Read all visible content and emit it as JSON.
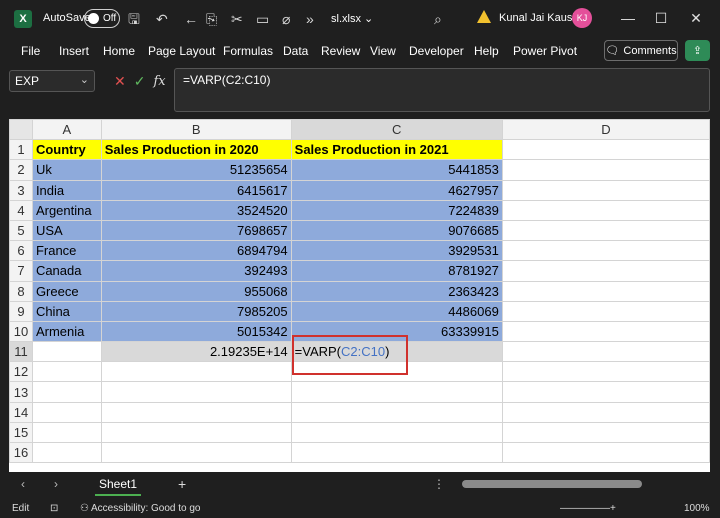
{
  "titlebar": {
    "autosave_label": "AutoSave",
    "autosave_state": "Off",
    "filename": "sl.xlsx",
    "user_name": "Kunal Jai Kaushik",
    "user_initials": "KJ",
    "logo": "X"
  },
  "menu": {
    "items": [
      "File",
      "Insert",
      "Home",
      "Page Layout",
      "Formulas",
      "Data",
      "Review",
      "View",
      "Developer",
      "Help",
      "Power Pivot"
    ],
    "comments_label": "Comments"
  },
  "formula_bar": {
    "name_box": "EXP",
    "formula": "=VARP(C2:C10)"
  },
  "sheet": {
    "columns": [
      "A",
      "B",
      "C",
      "D"
    ],
    "rows": [
      "1",
      "2",
      "3",
      "4",
      "5",
      "6",
      "7",
      "8",
      "9",
      "10",
      "11",
      "12",
      "13",
      "14",
      "15",
      "16"
    ],
    "header": {
      "a": "Country",
      "b": "Sales Production in 2020",
      "c": "Sales Production in 2021"
    },
    "data": [
      {
        "country": "Uk",
        "y2020": "51235654",
        "y2021": "5441853"
      },
      {
        "country": "India",
        "y2020": "6415617",
        "y2021": "4627957"
      },
      {
        "country": "Argentina",
        "y2020": "3524520",
        "y2021": "7224839"
      },
      {
        "country": "USA",
        "y2020": "7698657",
        "y2021": "9076685"
      },
      {
        "country": "France",
        "y2020": "6894794",
        "y2021": "3929531"
      },
      {
        "country": "Canada",
        "y2020": "392493",
        "y2021": "8781927"
      },
      {
        "country": "Greece",
        "y2020": "955068",
        "y2021": "2363423"
      },
      {
        "country": "China",
        "y2020": "7985205",
        "y2021": "4486069"
      },
      {
        "country": "Armenia",
        "y2020": "5015342",
        "y2021": "63339915"
      }
    ],
    "row11": {
      "b": "2.19235E+14",
      "c_prefix": "=VARP(",
      "c_ref": "C2:C10",
      "c_suffix": ")"
    }
  },
  "tabs": {
    "sheet_name": "Sheet1",
    "add": "+"
  },
  "status": {
    "mode": "Edit",
    "accessibility": "Accessibility: Good to go",
    "zoom": "100%"
  }
}
